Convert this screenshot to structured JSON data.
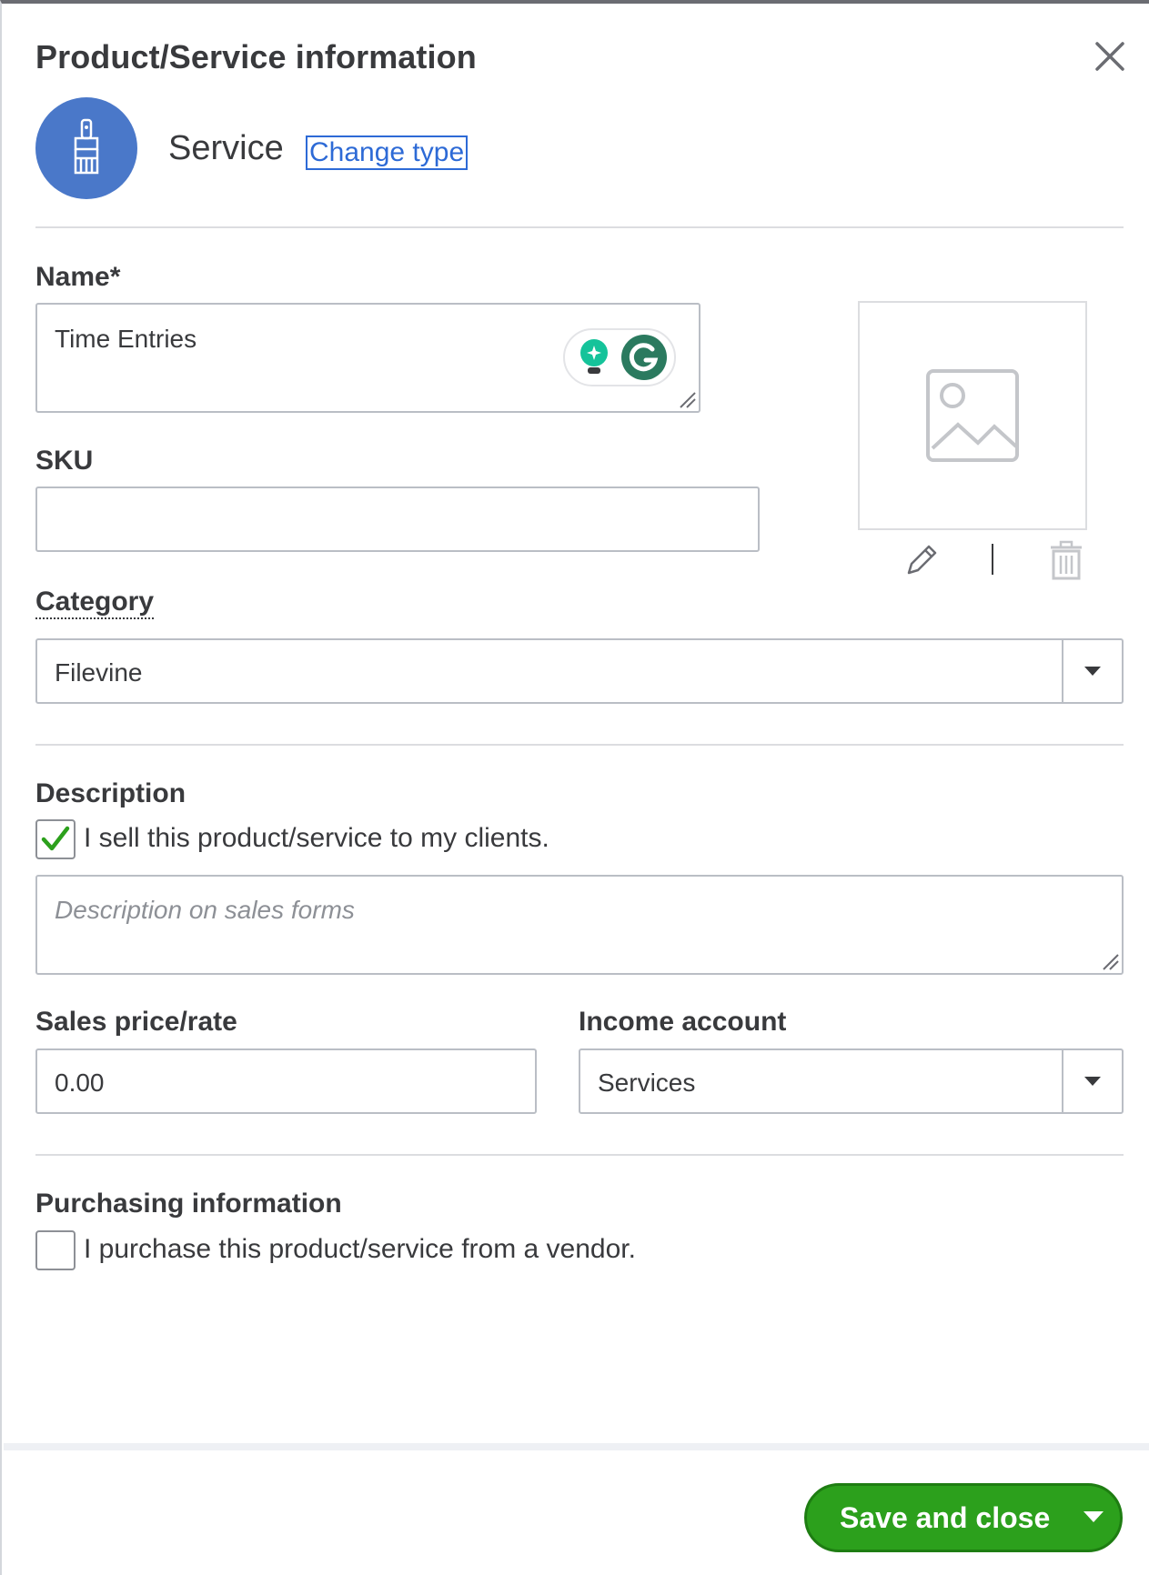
{
  "dialog": {
    "title": "Product/Service information",
    "close_icon": "close-icon"
  },
  "type_section": {
    "icon": "paintbrush-icon",
    "type_label": "Service",
    "change_type_link": "Change type"
  },
  "name_field": {
    "label": "Name*",
    "value": "Time Entries"
  },
  "sku_field": {
    "label": "SKU",
    "value": ""
  },
  "image": {
    "placeholder_icon": "image-placeholder-icon",
    "edit_icon": "pencil-icon",
    "separator": "|",
    "delete_icon": "trash-icon"
  },
  "category_field": {
    "label": "Category",
    "value": "Filevine"
  },
  "description_section": {
    "label": "Description",
    "sell_checkbox_label": "I sell this product/service to my clients.",
    "sell_checked": true,
    "placeholder": "Description on sales forms"
  },
  "sales_price_field": {
    "label": "Sales price/rate",
    "value": "0.00"
  },
  "income_account_field": {
    "label": "Income account",
    "value": "Services"
  },
  "purchasing_section": {
    "label": "Purchasing information",
    "purchase_checkbox_label": "I purchase this product/service from a vendor.",
    "purchase_checked": false
  },
  "footer": {
    "save_button_label": "Save and close"
  },
  "colors": {
    "accent_blue": "#2d6ad6",
    "type_circle": "#4a78c9",
    "save_green": "#2ca01c",
    "check_green": "#2ca01c",
    "grammarly_green": "#15c39a"
  }
}
